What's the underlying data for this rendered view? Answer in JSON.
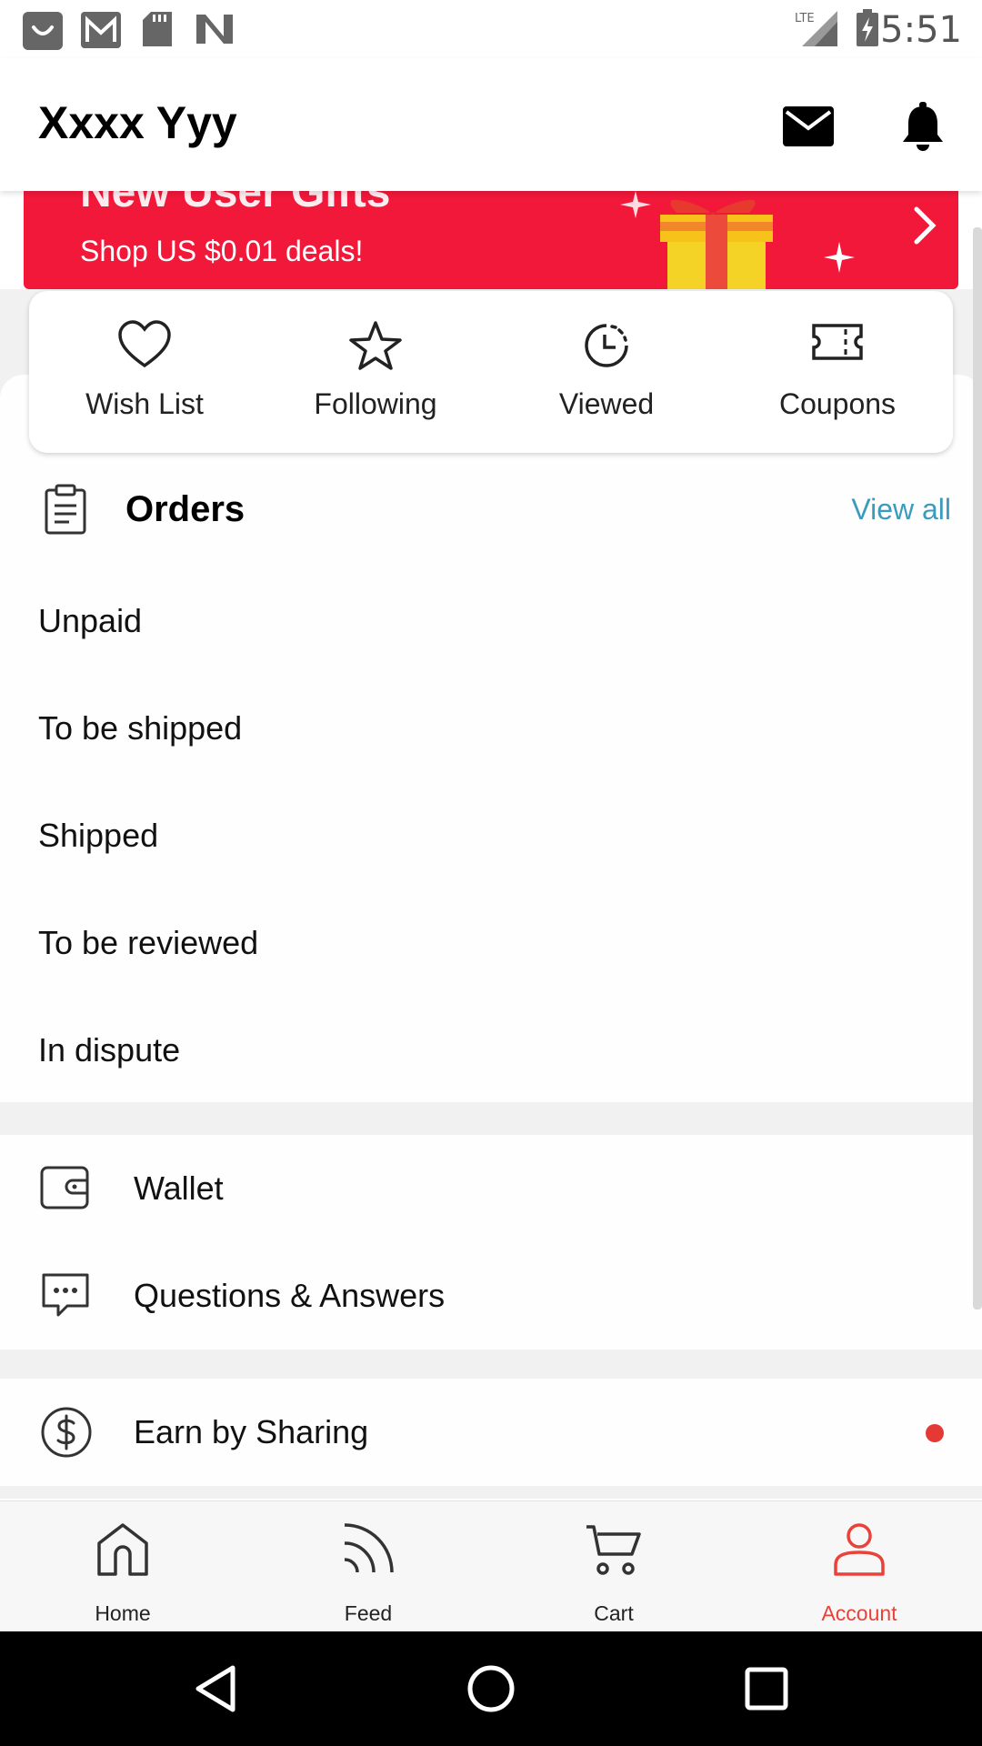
{
  "status_bar": {
    "time": "5:51",
    "network_label": "LTE",
    "left_icons": [
      "store-notification-icon",
      "gmail-icon",
      "sd-card-icon",
      "n-logo-icon"
    ]
  },
  "header": {
    "user_name": "Xxxx Yyy",
    "icons": [
      "mail-icon",
      "bell-icon"
    ]
  },
  "banner": {
    "title": "New User Gifts",
    "subtitle": "Shop US $0.01 deals!",
    "color": "#f2183a"
  },
  "quick_links": [
    {
      "label": "Wish List",
      "icon": "heart-icon"
    },
    {
      "label": "Following",
      "icon": "star-icon"
    },
    {
      "label": "Viewed",
      "icon": "clock-icon"
    },
    {
      "label": "Coupons",
      "icon": "coupon-icon"
    }
  ],
  "orders": {
    "title": "Orders",
    "view_all": "View all",
    "items": [
      "Unpaid",
      "To be shipped",
      "Shipped",
      "To be reviewed",
      "In dispute"
    ]
  },
  "menu": {
    "wallet": "Wallet",
    "qa": "Questions & Answers",
    "earn": "Earn by Sharing"
  },
  "bottom_nav": {
    "items": [
      {
        "label": "Home",
        "icon": "home-icon"
      },
      {
        "label": "Feed",
        "icon": "feed-icon"
      },
      {
        "label": "Cart",
        "icon": "cart-icon"
      },
      {
        "label": "Account",
        "icon": "account-icon"
      }
    ],
    "active": "Account",
    "accent": "#e8423a"
  },
  "colors": {
    "link": "#3a9bbd",
    "badge": "#e53935"
  }
}
